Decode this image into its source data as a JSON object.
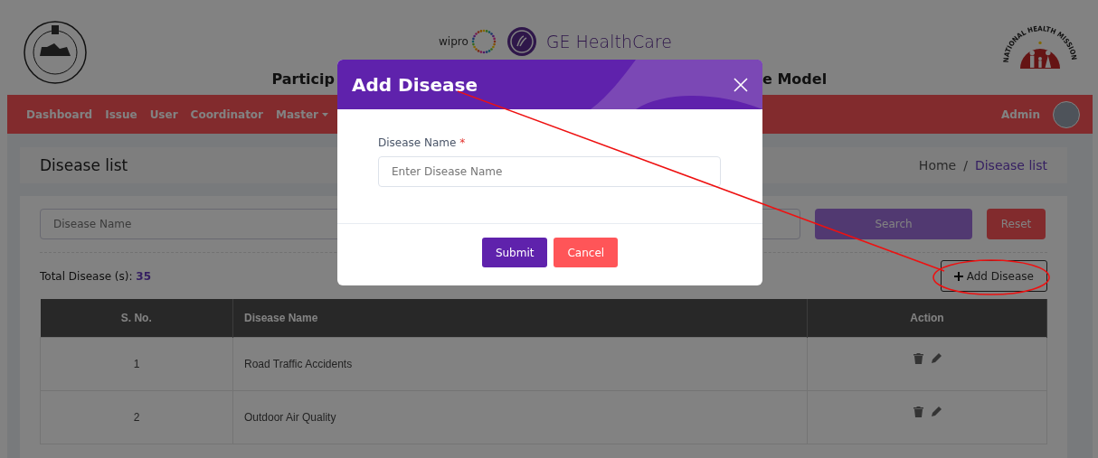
{
  "header": {
    "wipro_logo_text": "wipro",
    "ge_logo_text": "GE HealthCare",
    "nhm_logo_text": "NATIONAL HEALTH MISSION",
    "title_start": "Particip",
    "title_end": "e Model"
  },
  "nav": {
    "items": [
      {
        "label": "Dashboard",
        "kind": "link"
      },
      {
        "label": "Issue",
        "kind": "link"
      },
      {
        "label": "User",
        "kind": "link"
      },
      {
        "label": "Coordinator",
        "kind": "link"
      },
      {
        "label": "Master",
        "kind": "dropdown"
      }
    ],
    "user": "Admin"
  },
  "page_title": "Disease list",
  "breadcrumb": [
    {
      "label": "Home",
      "selected": false
    },
    {
      "label": "Disease list",
      "selected": true
    }
  ],
  "breadcrumb_separator": "/",
  "filter": {
    "placeholder": "Disease Name",
    "search": "Search",
    "reset": "Reset"
  },
  "total": {
    "label": "Total Disease (s):",
    "count": "35"
  },
  "add_button": "Add Disease",
  "table": {
    "columns": [
      "S. No.",
      "Disease Name",
      "Action"
    ],
    "rows": [
      {
        "sno": "1",
        "name": "Road Traffic Accidents"
      },
      {
        "sno": "2",
        "name": "Outdoor Air Quality"
      }
    ]
  },
  "modal": {
    "title": "Add Disease",
    "field_label": "Disease Name",
    "required_mark": "*",
    "placeholder": "Enter Disease Name",
    "buttons": [
      {
        "label": "Submit",
        "kind": "primary"
      },
      {
        "label": "Cancel",
        "kind": "danger"
      }
    ]
  }
}
